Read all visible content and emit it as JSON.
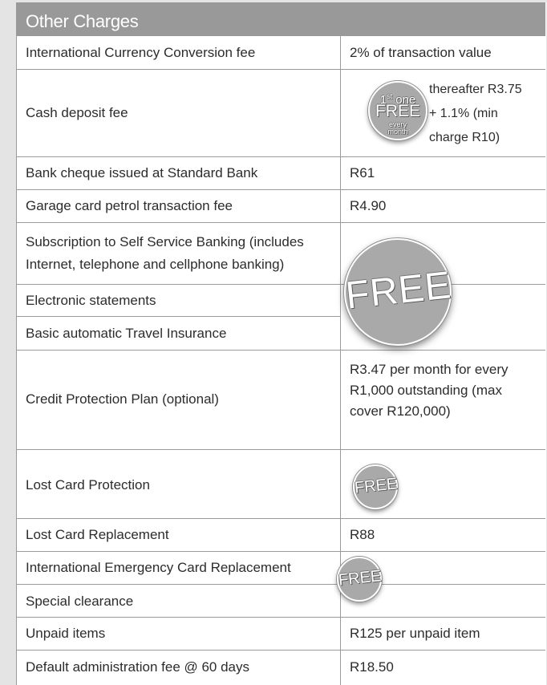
{
  "section_title": "Other Charges",
  "rows": [
    {
      "label": "International Currency Conversion fee",
      "value": "2% of transaction value"
    },
    {
      "label": "Cash deposit fee",
      "value": "thereafter R3.75 + 1.1% (min charge R10)"
    },
    {
      "label": "Bank cheque issued at Standard Bank",
      "value": "R61"
    },
    {
      "label": "Garage card petrol transaction fee",
      "value": "R4.90"
    },
    {
      "label": "Subscription to Self Service Banking (includes Internet, telephone and cellphone banking)",
      "value": ""
    },
    {
      "label": "Electronic statements",
      "value": ""
    },
    {
      "label": "Basic automatic Travel Insurance",
      "value": ""
    },
    {
      "label": "Credit Protection Plan (optional)",
      "value": "R3.47 per month for every R1,000 outstanding (max cover R120,000)"
    },
    {
      "label": "Lost Card Protection",
      "value": ""
    },
    {
      "label": "Lost Card Replacement",
      "value": "R88"
    },
    {
      "label": "International Emergency Card Replacement",
      "value": ""
    },
    {
      "label": "Special clearance",
      "value": ""
    },
    {
      "label": "Unpaid items",
      "value": "R125 per unpaid item"
    },
    {
      "label": "Default administration fee @ 60 days",
      "value": "R18.50"
    }
  ],
  "cash_deposit": {
    "line1": "thereafter R3.75",
    "line2": "+ 1.1% (min",
    "line3": "charge R10)"
  },
  "credit_protection": {
    "line1": "R3.47 per month for every",
    "line2": "R1,000 outstanding (max",
    "line3": "cover R120,000)"
  },
  "badges": {
    "first_one_sup": "st",
    "first_one_num": "1",
    "first_one_word": "one",
    "first_one_free": "FREE",
    "first_one_every": "every",
    "first_one_month": "month",
    "big_free": "FREE",
    "small_free": "FREE"
  },
  "colors": {
    "header_bg": "#999999",
    "badge_bg": "#a9a9a9",
    "grid": "#9a9a9a",
    "page_bg": "#e4e4e4"
  }
}
